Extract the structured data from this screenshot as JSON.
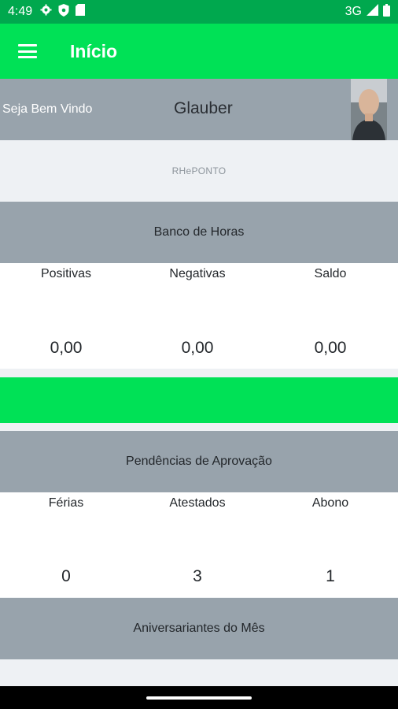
{
  "status_bar": {
    "time": "4:49",
    "network": "3G",
    "icons": [
      "gear-icon",
      "shield-icon",
      "sim-card-icon",
      "signal-icon",
      "battery-icon"
    ]
  },
  "app_bar": {
    "title": "Início",
    "menu_icon": "hamburger-menu-icon"
  },
  "welcome": {
    "greeting": "Seja Bem Vindo",
    "user_name": "Glauber"
  },
  "brand": {
    "label": "RHePONTO"
  },
  "banco_horas": {
    "title": "Banco de Horas",
    "columns": [
      {
        "label": "Positivas",
        "value": "0,00"
      },
      {
        "label": "Negativas",
        "value": "0,00"
      },
      {
        "label": "Saldo",
        "value": "0,00"
      }
    ]
  },
  "pendencias": {
    "title": "Pendências de Aprovação",
    "columns": [
      {
        "label": "Férias",
        "value": "0"
      },
      {
        "label": "Atestados",
        "value": "3"
      },
      {
        "label": "Abono",
        "value": "1"
      }
    ]
  },
  "aniversariantes": {
    "title": "Aniversariantes do Mês"
  },
  "colors": {
    "primary": "#00e156",
    "status_bar": "#00a84e",
    "section_gray": "#98a3ac",
    "background": "#eef1f4"
  }
}
